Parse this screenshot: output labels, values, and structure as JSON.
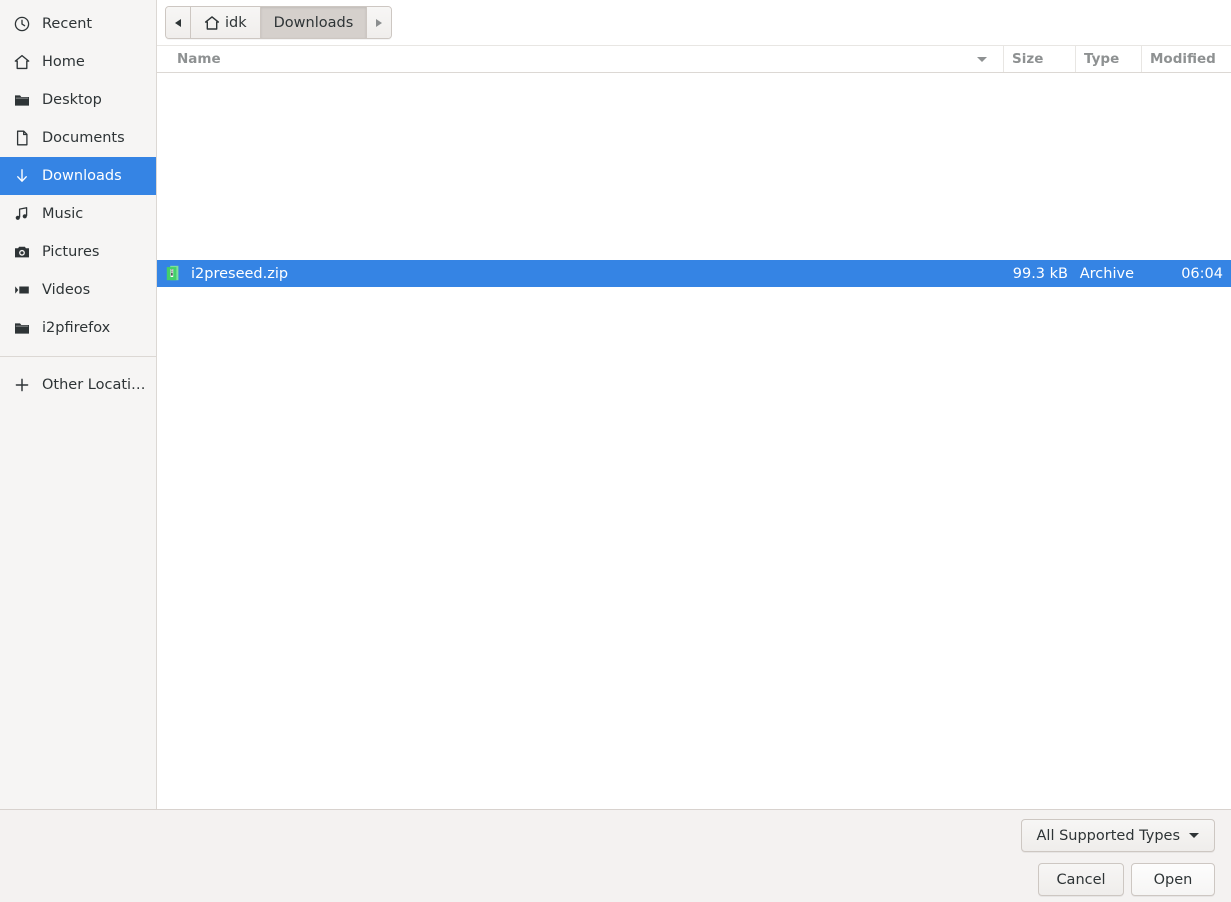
{
  "sidebar": {
    "items": [
      {
        "label": "Recent",
        "icon": "clock-icon",
        "selected": false
      },
      {
        "label": "Home",
        "icon": "home-icon",
        "selected": false
      },
      {
        "label": "Desktop",
        "icon": "folder-icon",
        "selected": false
      },
      {
        "label": "Documents",
        "icon": "document-icon",
        "selected": false
      },
      {
        "label": "Downloads",
        "icon": "download-icon",
        "selected": true
      },
      {
        "label": "Music",
        "icon": "music-icon",
        "selected": false
      },
      {
        "label": "Pictures",
        "icon": "camera-icon",
        "selected": false
      },
      {
        "label": "Videos",
        "icon": "video-icon",
        "selected": false
      },
      {
        "label": "i2pfirefox",
        "icon": "folder-icon",
        "selected": false
      }
    ],
    "other_locations": {
      "label": "Other Locations",
      "icon": "plus-icon"
    }
  },
  "pathbar": {
    "back_label": "",
    "forward_label": "",
    "crumbs": [
      {
        "label": "idk",
        "icon": "home-icon",
        "active": false
      },
      {
        "label": "Downloads",
        "icon": "",
        "active": true
      }
    ]
  },
  "columns": {
    "name": "Name",
    "size": "Size",
    "type": "Type",
    "modified": "Modified",
    "sort_column": "Name",
    "sort_direction": "descending"
  },
  "files": [
    {
      "name": "i2preseed.zip",
      "size": "99.3 kB",
      "type": "Archive",
      "modified": "06:04",
      "icon": "archive-icon",
      "selected": true
    }
  ],
  "action_bar": {
    "filter_label": "All Supported Types",
    "cancel_label": "Cancel",
    "open_label": "Open"
  },
  "colors": {
    "selection_blue": "#3584e4",
    "sidebar_bg": "#f6f5f4",
    "action_bar_bg": "#f4f2f1",
    "border": "#dcd8d4",
    "header_text": "#8e9192",
    "archive_green": "#4ed16e"
  }
}
